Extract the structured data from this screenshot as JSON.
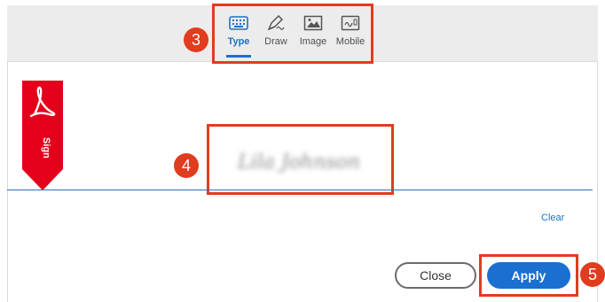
{
  "tabs": [
    {
      "label": "Type",
      "icon": "keyboard-icon",
      "active": true
    },
    {
      "label": "Draw",
      "icon": "pen-icon",
      "active": false
    },
    {
      "label": "Image",
      "icon": "image-icon",
      "active": false
    },
    {
      "label": "Mobile",
      "icon": "mobile-icon",
      "active": false
    }
  ],
  "ribbon": {
    "label": "Sign"
  },
  "signature": {
    "value": "Lila Johnson"
  },
  "actions": {
    "clear_label": "Clear",
    "close_label": "Close",
    "apply_label": "Apply"
  },
  "callouts": {
    "tabs": "3",
    "signature": "4",
    "apply": "5"
  },
  "colors": {
    "accent": "#1a73c8",
    "callout": "#e03c1f",
    "ribbon": "#e4001b"
  }
}
